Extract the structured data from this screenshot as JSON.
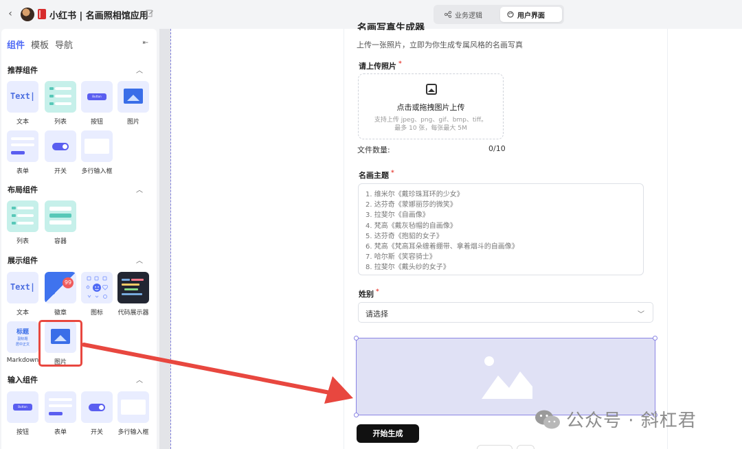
{
  "header": {
    "app_title": "小红书 | 名画照相馆应用",
    "view_tabs": [
      {
        "label": "业务逻辑",
        "active": false
      },
      {
        "label": "用户界面",
        "active": true
      }
    ]
  },
  "left_panel": {
    "tabs": [
      {
        "label": "组件",
        "active": true
      },
      {
        "label": "模板",
        "active": false
      },
      {
        "label": "导航",
        "active": false
      }
    ],
    "sections": [
      {
        "title": "推荐组件",
        "items": [
          "文本",
          "列表",
          "按钮",
          "图片",
          "表单",
          "开关",
          "多行输入框"
        ]
      },
      {
        "title": "布局组件",
        "items": [
          "列表",
          "容器"
        ]
      },
      {
        "title": "展示组件",
        "items": [
          "文本",
          "徽章",
          "图标",
          "代码展示器",
          "Markdown",
          "图片"
        ]
      },
      {
        "title": "输入组件",
        "items": [
          "按钮",
          "表单",
          "开关",
          "多行输入框"
        ]
      }
    ],
    "thumb_texts": {
      "text": "Text|",
      "button": "Button",
      "badge": "99",
      "md_title": "标题",
      "md_sub1": "副标题",
      "md_sub2": "居中正文"
    }
  },
  "form": {
    "title": "名画写真生成器",
    "description": "上传一张照片，立即为你生成专属风格的名画写真",
    "upload": {
      "label": "请上传照片",
      "required_mark": "*",
      "main_text": "点击或拖拽图片上传",
      "hint1": "支持上传 jpeg、png、gif、bmp、tiff。",
      "hint2": "最多 10 张，每张最大 5M",
      "count_label": "文件数量:",
      "count_value": "0/10"
    },
    "theme": {
      "label": "名画主题",
      "required_mark": "*",
      "lines": [
        "1. 维米尔《戴珍珠耳环的少女》",
        "2. 达芬奇《蒙娜丽莎的微笑》",
        "3. 拉斐尔《自画像》",
        "4. 梵高《戴灰毡帽的自画像》",
        "5. 达芬奇《抱貂的女子》",
        "6. 梵高《梵高耳朵缠着绷带、拿着烟斗的自画像》",
        "7. 哈尔斯《笑容骑士》",
        "8. 拉斐尔《戴头纱的女子》"
      ]
    },
    "gender": {
      "label": "姓别",
      "required_mark": "*",
      "placeholder": "请选择"
    },
    "generate_button": "开始生成"
  },
  "watermark": {
    "text": "公众号 · 斜杠君"
  },
  "colors": {
    "accent": "#4f6af5",
    "highlight_red": "#e8473f",
    "selection_purple": "#8a84e4",
    "placeholder_fill": "#e0e1f5"
  }
}
